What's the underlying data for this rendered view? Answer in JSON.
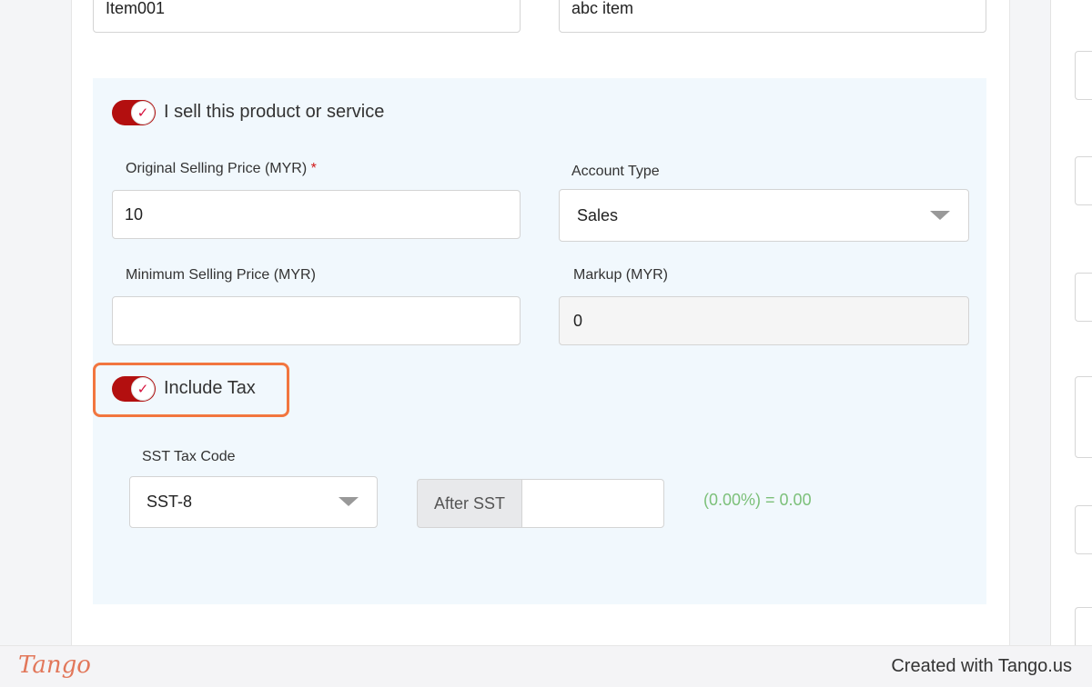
{
  "item": {
    "code_value": "Item001",
    "name_value": "abc item"
  },
  "sell_section": {
    "toggle_label": "I sell this product or service",
    "toggle_checked": true,
    "original_price_label": "Original Selling Price (MYR)",
    "required_mark": "*",
    "original_price_value": "10",
    "account_type_label": "Account Type",
    "account_type_value": "Sales",
    "min_price_label": "Minimum Selling Price (MYR)",
    "min_price_value": "",
    "markup_label": "Markup (MYR)",
    "markup_value": "0",
    "include_tax_label": "Include Tax",
    "include_tax_checked": true,
    "sst_label": "SST Tax Code",
    "sst_value": "SST-8",
    "after_sst_label": "After SST",
    "after_sst_value": "",
    "tax_result": "(0.00%) = 0.00"
  },
  "footer": {
    "logo": "Tango",
    "credit": "Created with Tango.us"
  },
  "colors": {
    "toggle_on": "#b30f0f",
    "check": "#d6103c",
    "highlight": "#f2763f",
    "tax_result": "#7cc079",
    "section_bg": "#f1f8fd"
  },
  "icons": {
    "toggle_check": "✓"
  }
}
